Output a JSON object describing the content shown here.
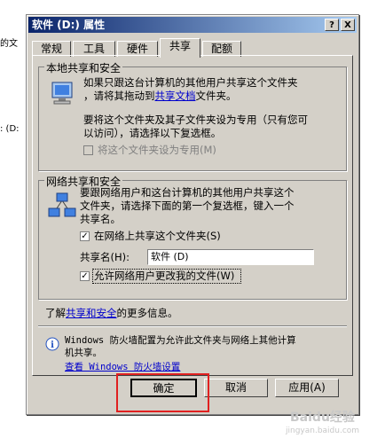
{
  "background": {
    "left_text_1": "的文",
    "left_text_2": ": (D:"
  },
  "dialog": {
    "title": "软件 (D:) 属性",
    "help_button": "?",
    "close_button": "X"
  },
  "tabs": [
    {
      "label": "常规"
    },
    {
      "label": "工具"
    },
    {
      "label": "硬件"
    },
    {
      "label": "共享"
    },
    {
      "label": "配额"
    }
  ],
  "local_sharing": {
    "title": "本地共享和安全",
    "desc_line1": "如果只跟这台计算机的其他用户共享这个文件夹",
    "desc_line2_prefix": "，请将其拖动到",
    "desc_line2_link": "共享文档",
    "desc_line2_suffix": "文件夹。",
    "private_line1": "要将这个文件夹及其子文件夹设为专用（只有您可",
    "private_line2": "以访问），请选择以下复选框。",
    "private_checkbox_label": "将这个文件夹设为专用(M)"
  },
  "network_sharing": {
    "title": "网络共享和安全",
    "desc_line1": "要跟网络用户和这台计算机的其他用户共享这个",
    "desc_line2": "文件夹，请选择下面的第一个复选框，键入一个",
    "desc_line3": "共享名。",
    "share_checkbox_label": "在网络上共享这个文件夹(S)",
    "share_name_label": "共享名(H):",
    "share_name_value": "软件 (D)",
    "allow_change_label": "允许网络用户更改我的文件(W)",
    "learn_more_prefix": "了解",
    "learn_more_link": "共享和安全",
    "learn_more_suffix": "的更多信息。"
  },
  "firewall": {
    "line1": "Windows 防火墙配置为允许此文件夹与网络上其他计算",
    "line2": "机共享。",
    "link": "查看 Windows 防火墙设置",
    "info_icon": "i"
  },
  "buttons": {
    "ok": "确定",
    "cancel": "取消",
    "apply": "应用(A)"
  },
  "watermark": {
    "main": "Baidu经验",
    "sub": "jingyan.baidu.com"
  }
}
